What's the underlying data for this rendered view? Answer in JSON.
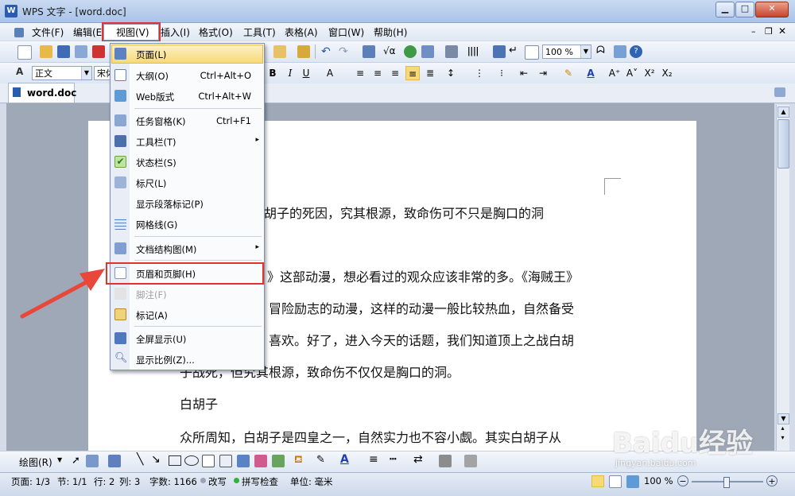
{
  "window": {
    "title": "WPS 文字 - [word.doc]",
    "app_icon_letter": "W"
  },
  "menubar": {
    "items": [
      "文件(F)",
      "编辑(E)",
      "视图(V)",
      "插入(I)",
      "格式(O)",
      "工具(T)",
      "表格(A)",
      "窗口(W)",
      "帮助(H)"
    ],
    "selected": "视图(V)"
  },
  "toolbar": {
    "zoom_value": "100 %",
    "style_value": "正文",
    "font_value": "宋体"
  },
  "tab": {
    "label": "word.doc"
  },
  "view_menu": {
    "items": [
      {
        "label": "页面(L)",
        "shortcut": "",
        "icon": "page-icon",
        "highlighted": true
      },
      {
        "label": "大纲(O)",
        "shortcut": "Ctrl+Alt+O",
        "icon": "outline-icon"
      },
      {
        "label": "Web版式",
        "shortcut": "Ctrl+Alt+W",
        "icon": "web-layout-icon"
      },
      {
        "label": "任务窗格(K)",
        "shortcut": "Ctrl+F1",
        "icon": "task-pane-icon"
      },
      {
        "label": "工具栏(T)",
        "shortcut": "",
        "icon": "toolbar-icon",
        "submenu": true
      },
      {
        "label": "状态栏(S)",
        "shortcut": "",
        "icon": "checkmark-icon",
        "checked": true
      },
      {
        "label": "标尺(L)",
        "shortcut": "",
        "icon": "ruler-icon"
      },
      {
        "label": "显示段落标记(P)",
        "shortcut": "",
        "icon": ""
      },
      {
        "label": "网格线(G)",
        "shortcut": "",
        "icon": "gridlines-icon"
      },
      {
        "label": "文档结构图(M)",
        "shortcut": "",
        "icon": "document-map-icon",
        "submenu": true
      },
      {
        "label": "页眉和页脚(H)",
        "shortcut": "",
        "icon": "header-footer-icon"
      },
      {
        "label": "脚注(F)",
        "shortcut": "",
        "icon": "footnote-icon",
        "disabled": true
      },
      {
        "label": "标记(A)",
        "shortcut": "",
        "icon": "markup-icon"
      },
      {
        "label": "全屏显示(U)",
        "shortcut": "",
        "icon": "fullscreen-icon"
      },
      {
        "label": "显示比例(Z)...",
        "shortcut": "",
        "icon": "zoom-icon"
      }
    ]
  },
  "document": {
    "lines": [
      "白胡子的死因，究其根源，致命伤可不只是胸口的洞",
      "》这部动漫，想必看过的观众应该非常的多。《海贼王》",
      "冒险励志的动漫，这样的动漫一般比较热血，自然备受",
      "喜欢。好了，进入今天的话题，我们知道顶上之战白胡",
      "子战死，但究其根源，致命伤不仅仅是胸口的洞。",
      "白胡子",
      "众所周知，白胡子是四皇之一，自然实力也不容小觑。其实白胡子从"
    ]
  },
  "drawbar": {
    "draw_label": "绘图(R)"
  },
  "statusbar": {
    "page": "页面: 1/3",
    "section": "节: 1/1",
    "row": "行: 2",
    "col": "列: 3",
    "words": "字数: 1166",
    "overwrite": "改写",
    "spellcheck": "拼写检查",
    "unit": "单位: 毫米",
    "zoom": "100 %"
  },
  "watermark": {
    "brand": "Baidu经验",
    "url": "jingyan.baidu.com"
  },
  "colors": {
    "highlight_red": "#e0332f",
    "menu_hover": "#f7d978",
    "titlebar": "#a9c3e8"
  }
}
